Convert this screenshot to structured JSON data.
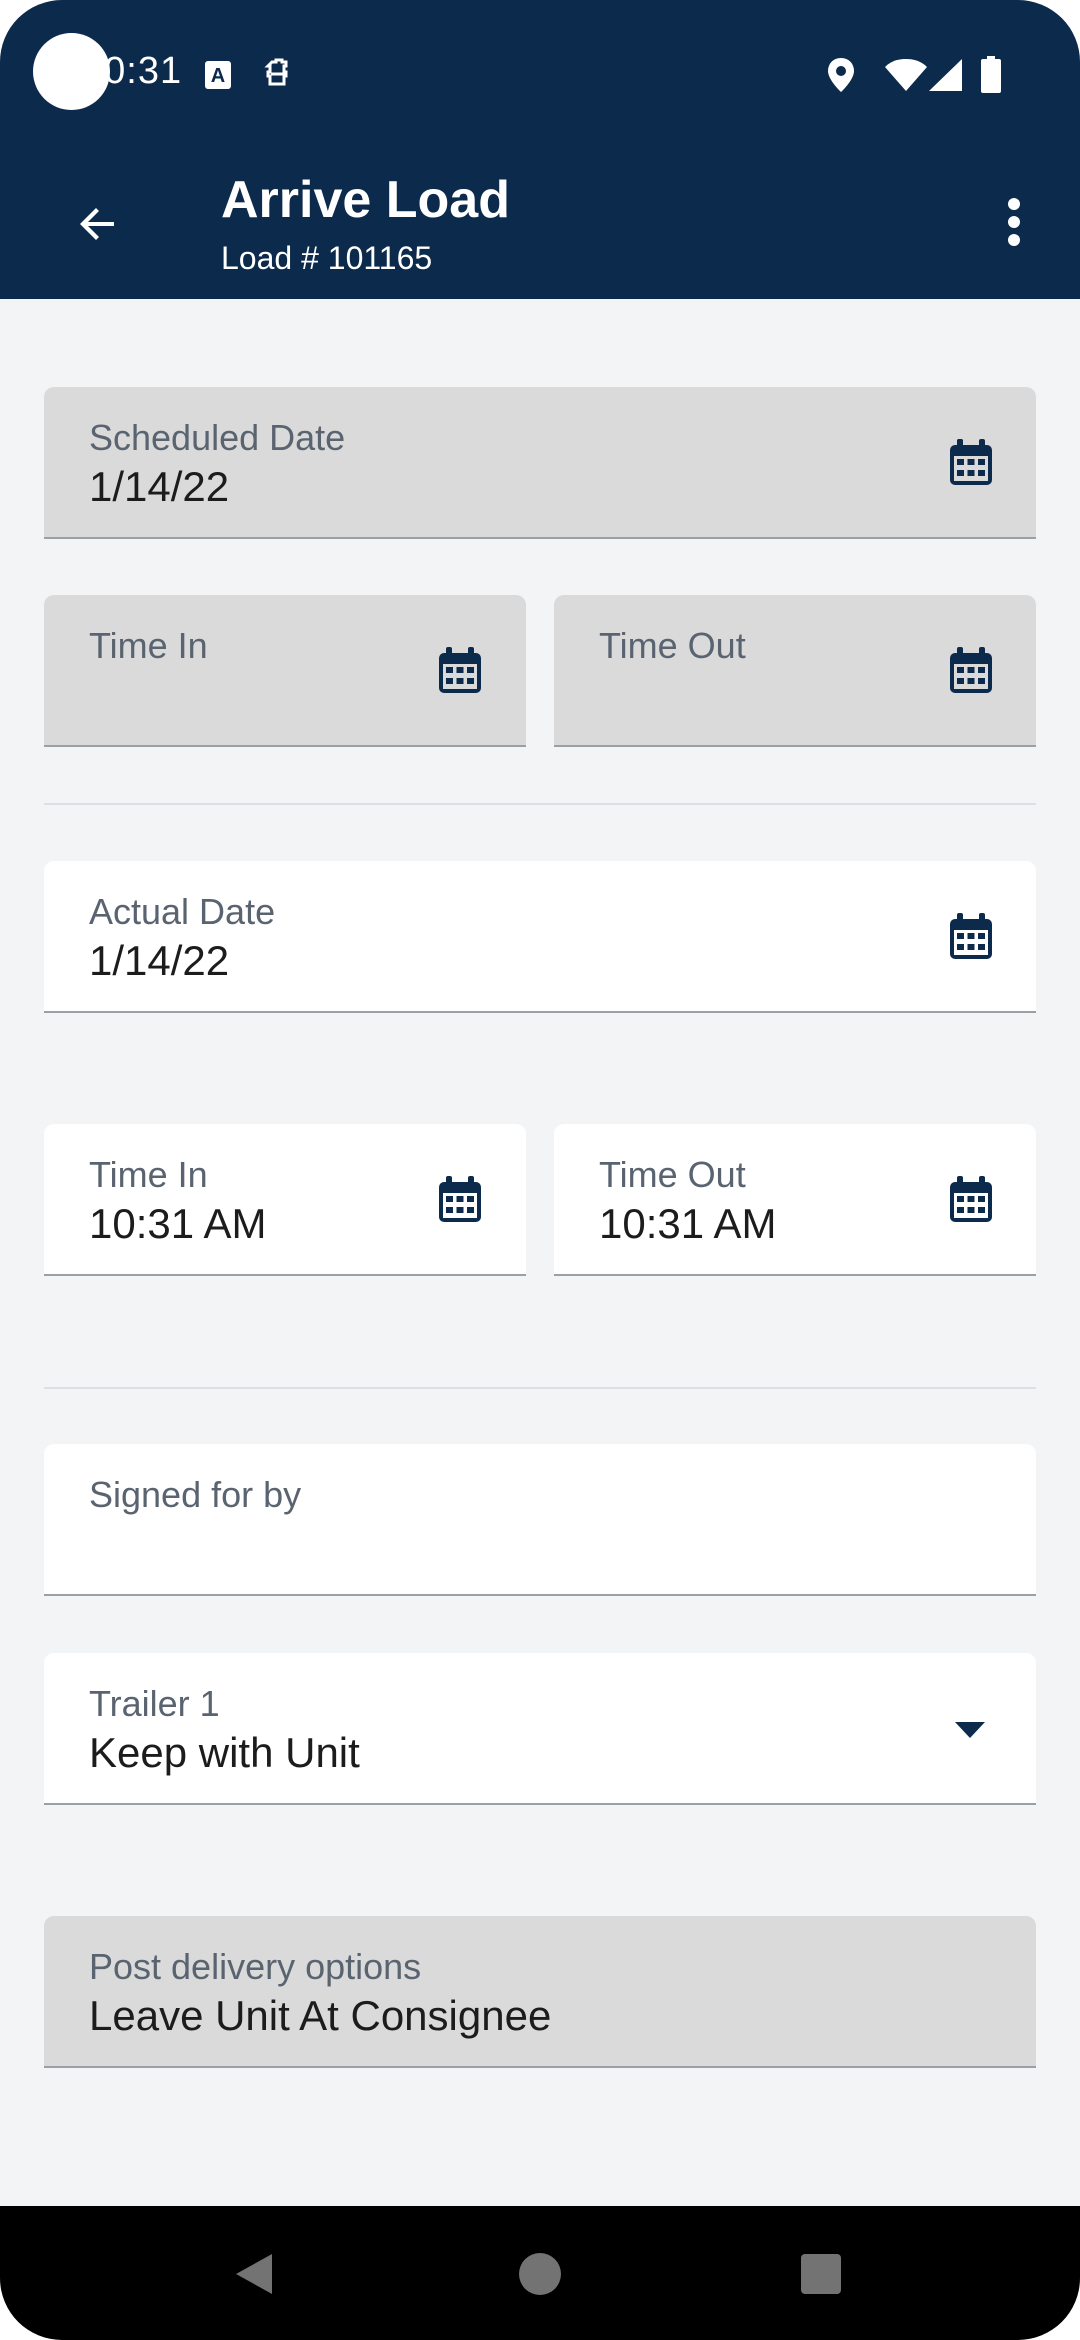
{
  "status_bar": {
    "time": "10:31",
    "icons": [
      "font-a-icon",
      "puzzle-icon",
      "location-icon",
      "wifi-icon",
      "signal-icon",
      "battery-icon"
    ]
  },
  "app_bar": {
    "title": "Arrive Load",
    "subtitle": "Load # 101165",
    "back_icon": "arrow-back-icon",
    "menu_icon": "more-vert-icon"
  },
  "scheduled": {
    "date_label": "Scheduled Date",
    "date_value": "1/14/22",
    "time_in_label": "Time In",
    "time_in_value": "",
    "time_out_label": "Time Out",
    "time_out_value": ""
  },
  "actual": {
    "date_label": "Actual Date",
    "date_value": "1/14/22",
    "time_in_label": "Time In",
    "time_in_value": "10:31 AM",
    "time_out_label": "Time Out",
    "time_out_value": "10:31 AM"
  },
  "signed_for_by": {
    "label": "Signed for by",
    "value": ""
  },
  "trailer": {
    "label": "Trailer 1",
    "value": "Keep with Unit"
  },
  "post_delivery": {
    "label": "Post delivery options",
    "value": "Leave Unit At Consignee"
  },
  "colors": {
    "primary": "#0c2a4c",
    "background": "#f3f4f6",
    "disabled_field": "#dadada"
  }
}
